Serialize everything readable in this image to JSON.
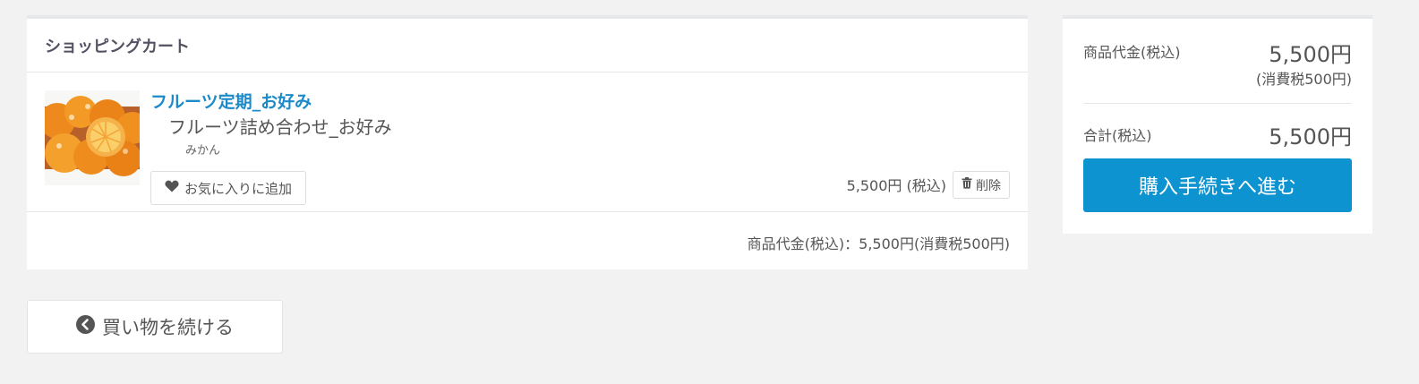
{
  "cart": {
    "title": "ショッピングカート",
    "item": {
      "name": "フルーツ定期_お好み",
      "subname": "フルーツ詰め合わせ_お好み",
      "variant": "みかん",
      "favorite_label": "お気に入りに追加",
      "price": "5,500円 (税込)",
      "delete_label": "削除"
    },
    "subtotal": "商品代金(税込)：5,500円(消費税500円)"
  },
  "continue_label": "買い物を続ける",
  "summary": {
    "product_label": "商品代金(税込)",
    "product_value": "5,500円",
    "tax_note": "(消費税500円)",
    "total_label": "合計(税込)",
    "total_value": "5,500円",
    "checkout_label": "購入手続きへ進む"
  },
  "colors": {
    "accent": "#0d93cf",
    "link": "#1c8ac9",
    "background": "#f2f2f2"
  },
  "icons": {
    "favorite": "heart-icon",
    "delete": "trash-icon",
    "continue": "chevron-left-circle-icon"
  }
}
